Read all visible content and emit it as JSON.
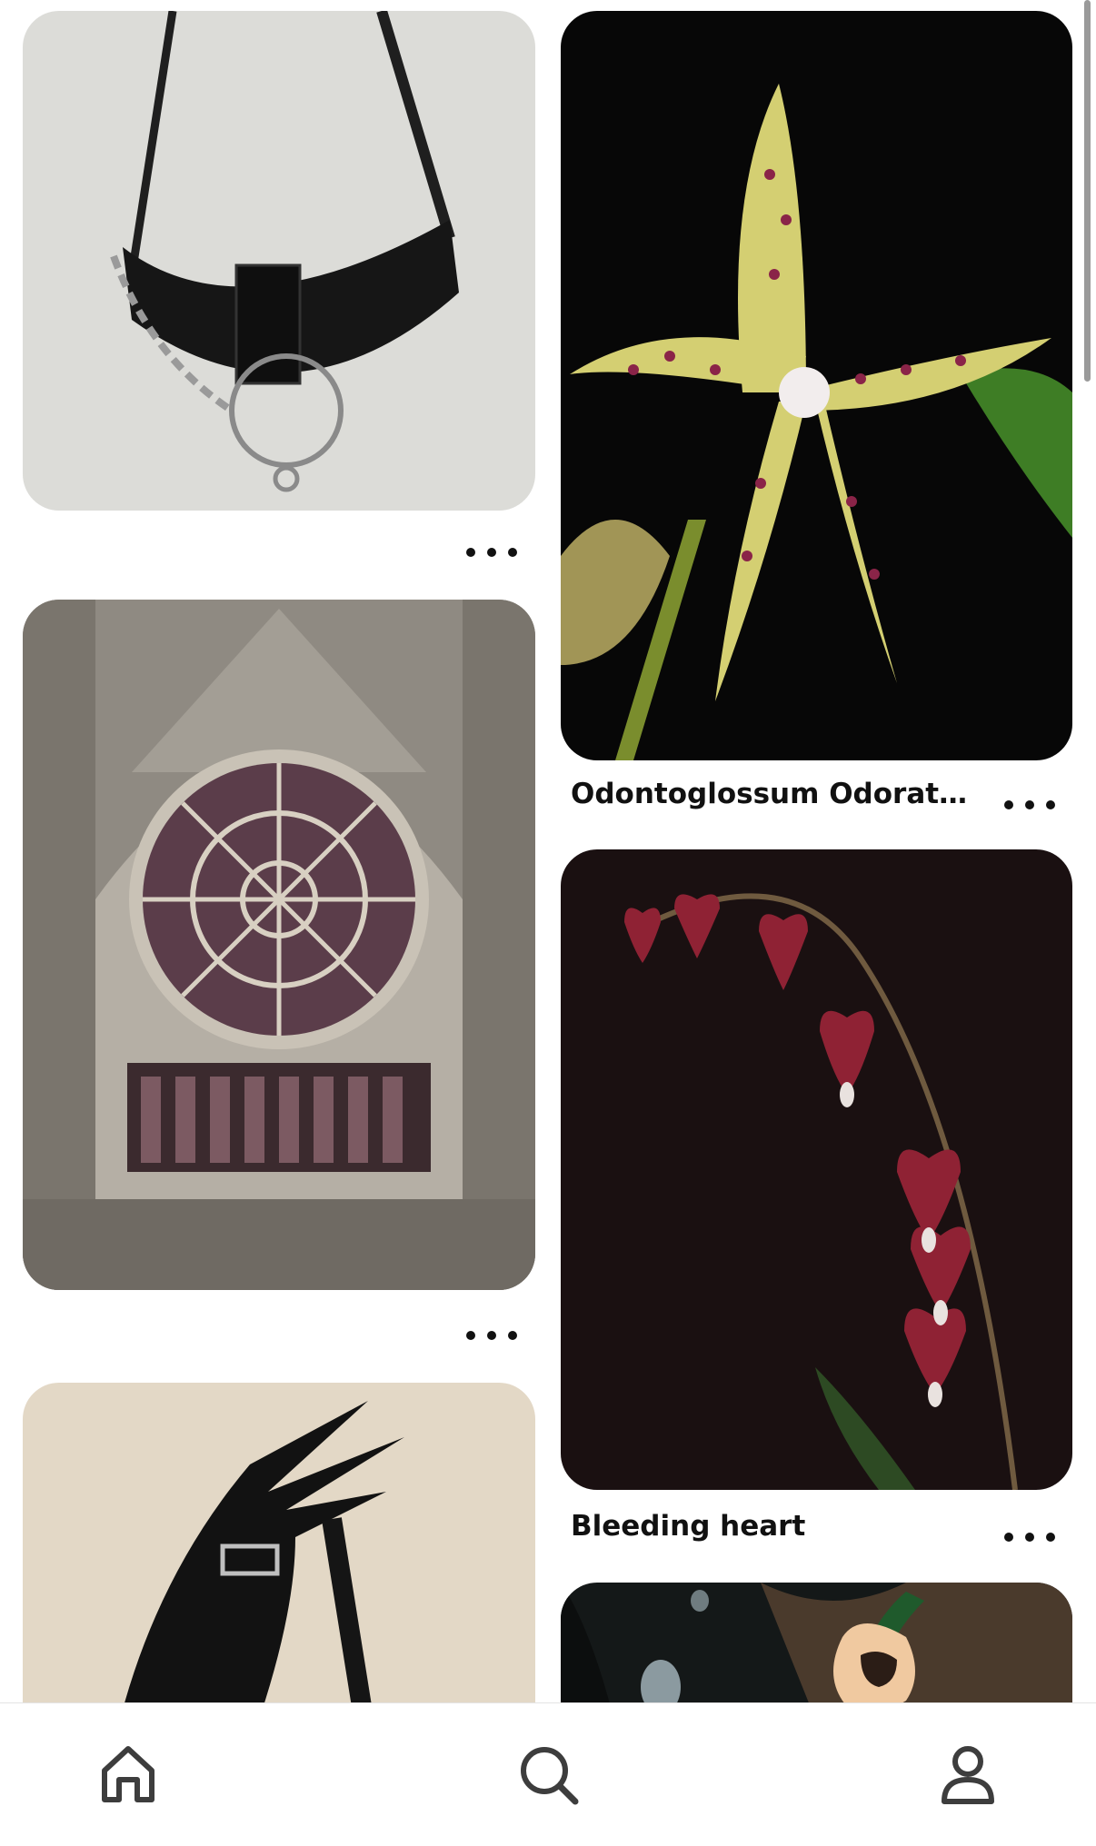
{
  "pins": [
    {
      "id": "handbag",
      "caption": ""
    },
    {
      "id": "orchid",
      "caption": "Odontoglossum Odoratu..."
    },
    {
      "id": "cathedral",
      "caption": ""
    },
    {
      "id": "bleeding-heart",
      "caption": "Bleeding heart"
    },
    {
      "id": "gloved-hand",
      "caption": ""
    },
    {
      "id": "water-drop-flower",
      "caption": ""
    }
  ],
  "nav": {
    "items": [
      {
        "name": "home",
        "icon": "home-icon"
      },
      {
        "name": "search",
        "icon": "search-icon"
      },
      {
        "name": "profile",
        "icon": "profile-icon"
      }
    ]
  },
  "colors": {
    "text": "#111111",
    "icon": "#3d3d3d",
    "background": "#ffffff"
  }
}
